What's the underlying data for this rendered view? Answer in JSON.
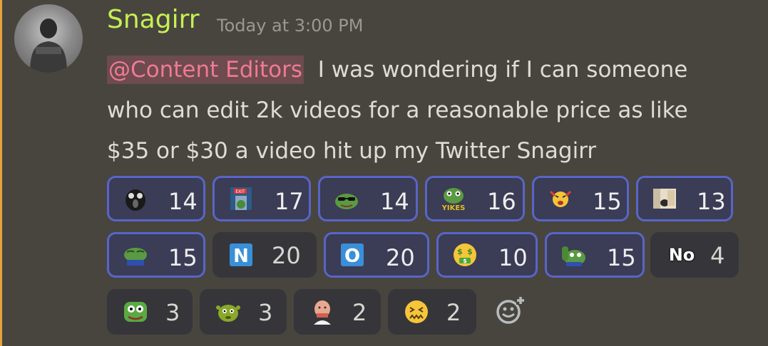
{
  "message": {
    "username": "Snagirr",
    "timestamp": "Today at 3:00 PM",
    "mention": "@Content Editors",
    "text_line1": "I was wondering if I can someone",
    "text_line2": "who can edit 2k videos for a reasonable price as like",
    "text_line3": "$35 or $30 a video hit up my Twitter Snagirr"
  },
  "reactions": [
    {
      "emoji": "shocked-face-emoji",
      "count": "14",
      "active": true
    },
    {
      "emoji": "exit-door-pepe-emoji",
      "count": "17",
      "active": true
    },
    {
      "emoji": "pepe-sunglasses-emoji",
      "count": "14",
      "active": true
    },
    {
      "emoji": "pepe-yikes-emoji",
      "count": "16",
      "active": true,
      "label": "YIKES"
    },
    {
      "emoji": "angry-face-emoji",
      "count": "15",
      "active": true
    },
    {
      "emoji": "photo-emoji",
      "count": "13",
      "active": true
    },
    {
      "emoji": "pepe-smug-emoji",
      "count": "15",
      "active": true
    },
    {
      "emoji": "letter-n-emoji",
      "count": "20",
      "active": false,
      "label": "N"
    },
    {
      "emoji": "letter-o-emoji",
      "count": "20",
      "active": true,
      "label": "O"
    },
    {
      "emoji": "money-mouth-face-emoji",
      "count": "10",
      "active": true
    },
    {
      "emoji": "pepe-hand-emoji",
      "count": "15",
      "active": true
    },
    {
      "emoji": "no-text-emoji",
      "count": "4",
      "active": false,
      "label": "No"
    },
    {
      "emoji": "pepe-face-emoji",
      "count": "3",
      "active": false
    },
    {
      "emoji": "shrek-face-emoji",
      "count": "3",
      "active": false
    },
    {
      "emoji": "bald-man-emoji",
      "count": "2",
      "active": false
    },
    {
      "emoji": "confounded-face-emoji",
      "count": "2",
      "active": false
    }
  ],
  "colors": {
    "background": "#48453f",
    "username": "#c6f051",
    "mention": "#f07a93",
    "active_border": "#5865c8",
    "accent_bar": "#e6a23c"
  }
}
